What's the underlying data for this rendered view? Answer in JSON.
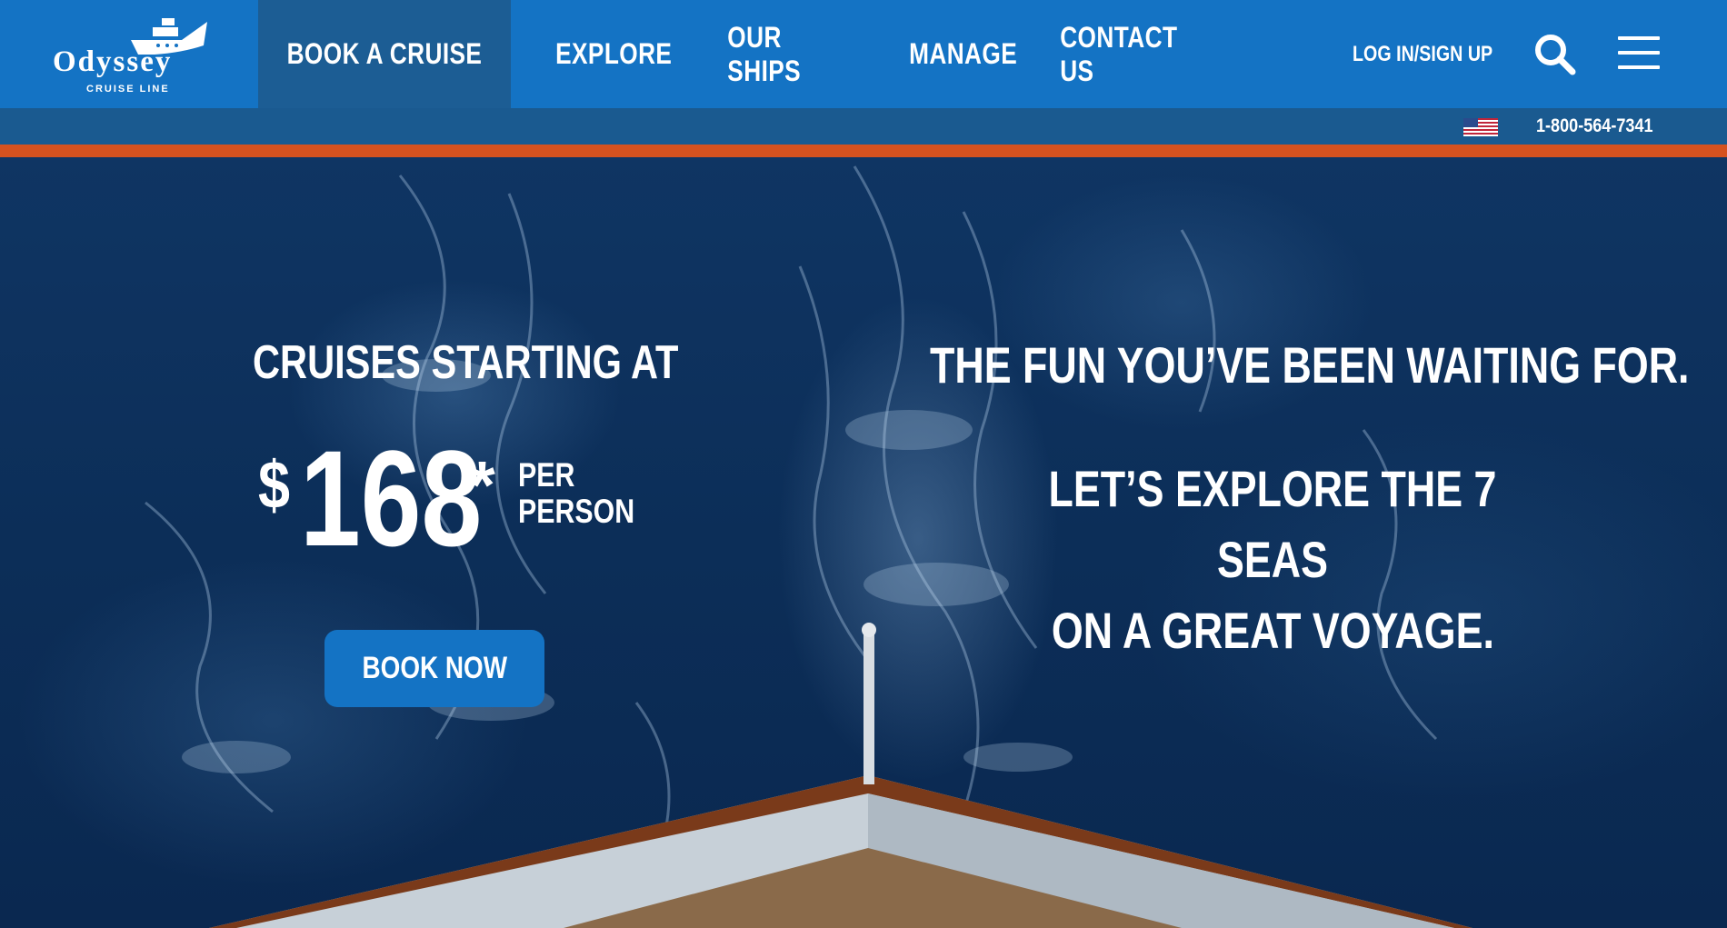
{
  "brand": {
    "name": "Odyssey",
    "subtitle": "CRUISE LINE"
  },
  "nav": {
    "items": [
      {
        "label": "BOOK A CRUISE",
        "active": true
      },
      {
        "label": "EXPLORE"
      },
      {
        "label": "OUR SHIPS"
      },
      {
        "label": "MANAGE"
      },
      {
        "label": "CONTACT US"
      }
    ],
    "login": "LOG IN/SIGN UP",
    "search_icon": "search-icon",
    "menu_icon": "hamburger-menu-icon"
  },
  "utility": {
    "flag_icon": "us-flag-icon",
    "phone": "1-800-564-7341"
  },
  "hero": {
    "starting_label": "CRUISES STARTING AT",
    "currency": "$",
    "price": "168",
    "asterisk": "*",
    "per_line1": "PER",
    "per_line2": "PERSON",
    "cta": "BOOK NOW",
    "tagline": "THE FUN YOU’VE BEEN WAITING FOR.",
    "sub_line1": "LET’S EXPLORE THE 7 SEAS",
    "sub_line2": "ON A GREAT VOYAGE."
  },
  "colors": {
    "primary_blue": "#1473c4",
    "active_blue": "#1c5d94",
    "accent_orange": "#d5521f",
    "sea_navy": "#0c2e58"
  }
}
